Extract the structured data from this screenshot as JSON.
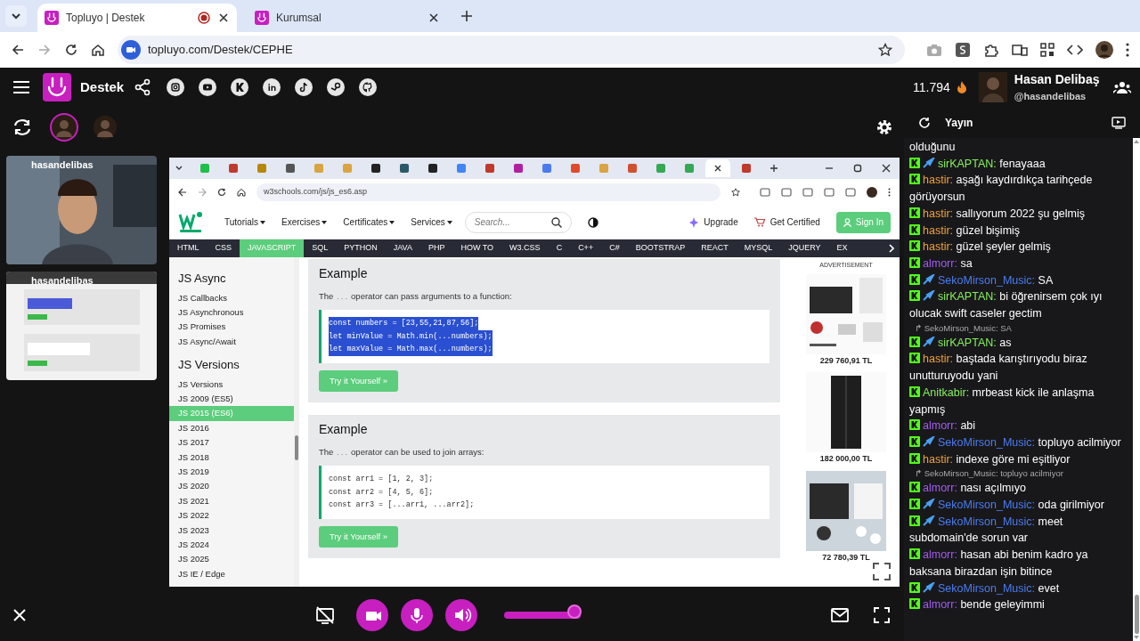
{
  "browser": {
    "tabs": [
      {
        "title": "Topluyo | Destek",
        "selected": true,
        "recording": true
      },
      {
        "title": "Kurumsal",
        "selected": false,
        "recording": false
      }
    ],
    "address": "topluyo.com/Destek/CEPHE"
  },
  "app_header": {
    "title": "Destek",
    "score": "11.794",
    "user_name": "Hasan Delibaş",
    "user_handle": "@hasandelibas"
  },
  "participants": [
    {
      "selected": true
    },
    {
      "selected": false
    }
  ],
  "chat_header": {
    "title": "Yayın"
  },
  "webcams": [
    {
      "label": "hasandelibas"
    },
    {
      "label": "hasandelibas"
    }
  ],
  "shared_screen": {
    "tabs": [
      {
        "color": "#1fbf4a",
        "selected": false
      },
      {
        "color": "#c0392b",
        "selected": false
      },
      {
        "color": "#b8860b",
        "selected": false
      },
      {
        "color": "#555555",
        "selected": false
      },
      {
        "color": "#d9a441",
        "selected": false
      },
      {
        "color": "#d9a441",
        "selected": false
      },
      {
        "color": "#222222",
        "selected": false
      },
      {
        "color": "#2a5a6a",
        "selected": false
      },
      {
        "color": "#222222",
        "selected": false
      },
      {
        "color": "#4285f4",
        "selected": false
      },
      {
        "color": "#c0392b",
        "selected": false
      },
      {
        "color": "#b0209e",
        "selected": false
      },
      {
        "color": "#4a7cf0",
        "selected": false
      },
      {
        "color": "#e04a2a",
        "selected": false
      },
      {
        "color": "#d9a441",
        "selected": false
      },
      {
        "color": "#d05030",
        "selected": false
      },
      {
        "color": "#34a853",
        "selected": false
      },
      {
        "color": "#34a853",
        "selected": false
      },
      {
        "selected": true
      },
      {
        "color": "#c0392b",
        "selected": false
      }
    ],
    "address": "w3schools.com/js/js_es6.asp",
    "menu": [
      "Tutorials",
      "Exercises",
      "Certificates",
      "Services"
    ],
    "search_placeholder": "Search...",
    "upgrade": "Upgrade",
    "certified": "Get Certified",
    "sign_in": "Sign In",
    "topnav": [
      {
        "label": "HTML",
        "selected": false
      },
      {
        "label": "CSS",
        "selected": false
      },
      {
        "label": "JAVASCRIPT",
        "selected": true
      },
      {
        "label": "SQL",
        "selected": false
      },
      {
        "label": "PYTHON",
        "selected": false
      },
      {
        "label": "JAVA",
        "selected": false
      },
      {
        "label": "PHP",
        "selected": false
      },
      {
        "label": "HOW TO",
        "selected": false
      },
      {
        "label": "W3.CSS",
        "selected": false
      },
      {
        "label": "C",
        "selected": false
      },
      {
        "label": "C++",
        "selected": false
      },
      {
        "label": "C#",
        "selected": false
      },
      {
        "label": "BOOTSTRAP",
        "selected": false
      },
      {
        "label": "REACT",
        "selected": false
      },
      {
        "label": "MYSQL",
        "selected": false
      },
      {
        "label": "JQUERY",
        "selected": false
      },
      {
        "label": "EX",
        "selected": false
      }
    ],
    "sidebar": [
      {
        "kind": "heading",
        "label": "JS Async"
      },
      {
        "kind": "item",
        "label": "JS Callbacks",
        "selected": false
      },
      {
        "kind": "item",
        "label": "JS Asynchronous",
        "selected": false
      },
      {
        "kind": "item",
        "label": "JS Promises",
        "selected": false
      },
      {
        "kind": "item",
        "label": "JS Async/Await",
        "selected": false
      },
      {
        "kind": "heading",
        "label": "JS Versions"
      },
      {
        "kind": "item",
        "label": "JS Versions",
        "selected": false
      },
      {
        "kind": "item",
        "label": "JS 2009 (ES5)",
        "selected": false
      },
      {
        "kind": "item",
        "label": "JS 2015 (ES6)",
        "selected": true
      },
      {
        "kind": "item",
        "label": "JS 2016",
        "selected": false
      },
      {
        "kind": "item",
        "label": "JS 2017",
        "selected": false
      },
      {
        "kind": "item",
        "label": "JS 2018",
        "selected": false
      },
      {
        "kind": "item",
        "label": "JS 2019",
        "selected": false
      },
      {
        "kind": "item",
        "label": "JS 2020",
        "selected": false
      },
      {
        "kind": "item",
        "label": "JS 2021",
        "selected": false
      },
      {
        "kind": "item",
        "label": "JS 2022",
        "selected": false
      },
      {
        "kind": "item",
        "label": "JS 2023",
        "selected": false
      },
      {
        "kind": "item",
        "label": "JS 2024",
        "selected": false
      },
      {
        "kind": "item",
        "label": "JS 2025",
        "selected": false
      },
      {
        "kind": "item",
        "label": "JS IE / Edge",
        "selected": false
      }
    ],
    "examples": [
      {
        "title": "Example",
        "before": "The",
        "code": "...",
        "after": "operator can pass arguments to a function:",
        "highlighted": true,
        "lines": [
          "const numbers = [23,55,21,87,56];",
          "let minValue = Math.min(...numbers);",
          "let maxValue = Math.max(...numbers);"
        ],
        "button": "Try it Yourself »"
      },
      {
        "title": "Example",
        "before": "The",
        "code": "...",
        "after": "operator can be used to join arrays:",
        "highlighted": false,
        "lines": [
          "const arr1 = [1, 2, 3];",
          "const arr2 = [4, 5, 6];",
          "const arr3 = [...arr1, ...arr2];"
        ],
        "button": "Try it Yourself »"
      }
    ],
    "ad": {
      "label": "ADVERTISEMENT",
      "prices": [
        "229 760,91 TL",
        "182 000,00 TL",
        "72 780,39 TL"
      ]
    }
  },
  "chat": [
    {
      "kind": "continuation",
      "text": "olduğunu"
    },
    {
      "kind": "message",
      "user": "sirKAPTAN:",
      "color": "#86f05a",
      "badge": true,
      "text": "fenayaaa"
    },
    {
      "kind": "message",
      "user": "hastir:",
      "color": "#f0a23a",
      "badge": false,
      "text": "aşağı kaydırdıkça tarihçede görüyorsun"
    },
    {
      "kind": "message",
      "user": "hastir:",
      "color": "#f0a23a",
      "badge": false,
      "text": "sallıyorum 2022 şu gelmiş"
    },
    {
      "kind": "message",
      "user": "hastir:",
      "color": "#f0a23a",
      "badge": false,
      "text": "güzel bişimiş"
    },
    {
      "kind": "message",
      "user": "hastir:",
      "color": "#f0a23a",
      "badge": false,
      "text": "güzel şeyler gelmiş"
    },
    {
      "kind": "message",
      "user": "almorr:",
      "color": "#a35cf0",
      "badge": false,
      "text": "sa"
    },
    {
      "kind": "message",
      "user": "SekoMirson_Music:",
      "color": "#4b7cf0",
      "badge": true,
      "text": "SA"
    },
    {
      "kind": "message",
      "user": "sirKAPTAN:",
      "color": "#86f05a",
      "badge": true,
      "text": "bi öğrenirsem çok ıyı olucak swift caseler gectim"
    },
    {
      "kind": "reply",
      "text": "↱ SekoMirson_Music: SA"
    },
    {
      "kind": "message",
      "user": "sirKAPTAN:",
      "color": "#86f05a",
      "badge": true,
      "text": "as"
    },
    {
      "kind": "message",
      "user": "hastir:",
      "color": "#f0a23a",
      "badge": false,
      "text": "baştada karıştırıyodu biraz unutturuyodu yani"
    },
    {
      "kind": "message",
      "user": "Anitkabir:",
      "color": "#86f05a",
      "badge": false,
      "text": "mrbeast kick ile anlaşma yapmış"
    },
    {
      "kind": "message",
      "user": "almorr:",
      "color": "#a35cf0",
      "badge": false,
      "text": "abi"
    },
    {
      "kind": "message",
      "user": "SekoMirson_Music:",
      "color": "#4b7cf0",
      "badge": true,
      "text": "topluyo acilmiyor"
    },
    {
      "kind": "message",
      "user": "hastir:",
      "color": "#f0a23a",
      "badge": false,
      "text": "indexe göre mi eşitliyor"
    },
    {
      "kind": "reply",
      "text": "↱ SekoMirson_Music: topluyo acilmiyor"
    },
    {
      "kind": "message",
      "user": "almorr:",
      "color": "#a35cf0",
      "badge": false,
      "text": "nası açılmıyo"
    },
    {
      "kind": "message",
      "user": "SekoMirson_Music:",
      "color": "#4b7cf0",
      "badge": true,
      "text": "oda girilmiyor"
    },
    {
      "kind": "message",
      "user": "SekoMirson_Music:",
      "color": "#4b7cf0",
      "badge": true,
      "text": "meet subdomain'de sorun var"
    },
    {
      "kind": "message",
      "user": "almorr:",
      "color": "#a35cf0",
      "badge": false,
      "text": "hasan abi benim kadro ya baksana birazdan işin bitince"
    },
    {
      "kind": "message",
      "user": "SekoMirson_Music:",
      "color": "#4b7cf0",
      "badge": true,
      "text": "evet"
    },
    {
      "kind": "message",
      "user": "almorr:",
      "color": "#a35cf0",
      "badge": false,
      "text": "bende geleyimmi"
    }
  ],
  "controls": {
    "screen_off": true,
    "volume": {
      "level": 0.92
    }
  }
}
